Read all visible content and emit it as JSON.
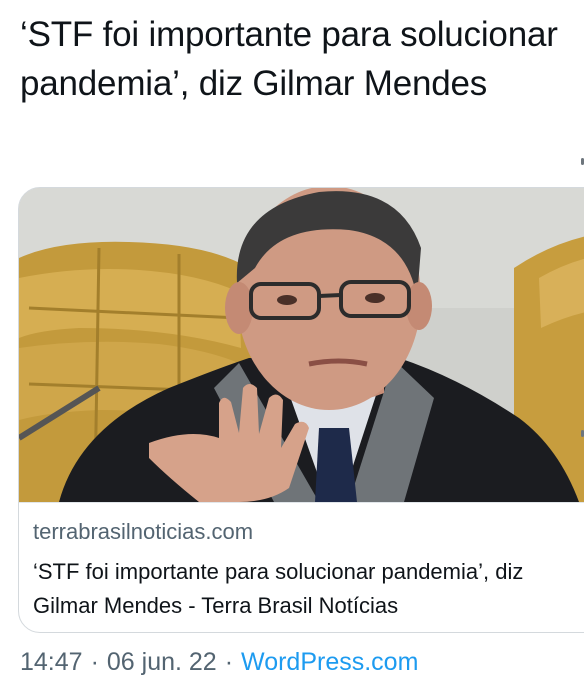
{
  "tweet": {
    "text": "‘STF foi importante para solucionar pandemia’, diz Gilmar Mendes"
  },
  "card": {
    "domain": "terrabrasilnoticias.com",
    "title": "‘STF foi importante para solucionar pandemia’, diz Gilmar Mendes - Terra Brasil Notícias"
  },
  "meta": {
    "time": "14:47",
    "separator": "·",
    "date": "06 jun. 22",
    "source": "WordPress.com"
  },
  "colors": {
    "text": "#0f1419",
    "secondary": "#536471",
    "link": "#1d9bf0",
    "border": "#d4d9dd"
  }
}
